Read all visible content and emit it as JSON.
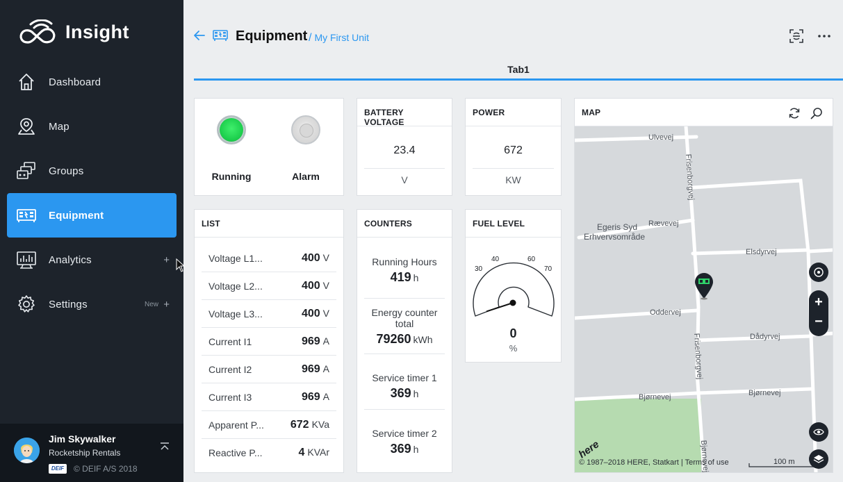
{
  "app": {
    "name": "Insight"
  },
  "sidebar": {
    "items": [
      {
        "label": "Dashboard",
        "icon": "home-icon"
      },
      {
        "label": "Map",
        "icon": "map-pin-icon"
      },
      {
        "label": "Groups",
        "icon": "groups-icon"
      },
      {
        "label": "Equipment",
        "icon": "equipment-icon",
        "active": true
      },
      {
        "label": "Analytics",
        "icon": "analytics-icon",
        "plus": "+"
      },
      {
        "label": "Settings",
        "icon": "gear-icon",
        "badge": "New",
        "plus": "+"
      }
    ]
  },
  "user": {
    "name": "Jim Skywalker",
    "org": "Rocketship Rentals",
    "brand": "DEIF",
    "copyright": "© DEIF A/S 2018"
  },
  "header": {
    "title": "Equipment",
    "crumb_sep": "/",
    "crumb": "My First Unit",
    "tab": "Tab1"
  },
  "status": {
    "running_label": "Running",
    "alarm_label": "Alarm"
  },
  "battery": {
    "title": "BATTERY VOLTAGE",
    "value": "23.4",
    "unit": "V"
  },
  "power": {
    "title": "POWER",
    "value": "672",
    "unit": "KW"
  },
  "list": {
    "title": "LIST",
    "rows": [
      {
        "key": "Voltage L1...",
        "value": "400",
        "unit": "V"
      },
      {
        "key": "Voltage L2...",
        "value": "400",
        "unit": "V"
      },
      {
        "key": "Voltage L3...",
        "value": "400",
        "unit": "V"
      },
      {
        "key": "Current I1",
        "value": "969",
        "unit": "A"
      },
      {
        "key": "Current I2",
        "value": "969",
        "unit": "A"
      },
      {
        "key": "Current I3",
        "value": "969",
        "unit": "A"
      },
      {
        "key": "Apparent P...",
        "value": "672",
        "unit": "KVa"
      },
      {
        "key": "Reactive P...",
        "value": "4",
        "unit": "KVAr"
      }
    ]
  },
  "counters": {
    "title": "COUNTERS",
    "items": [
      {
        "label": "Running Hours",
        "value": "419",
        "unit": "h"
      },
      {
        "label": "Energy counter total",
        "value": "79260",
        "unit": "kWh"
      },
      {
        "label": "Service timer 1",
        "value": "369",
        "unit": "h"
      },
      {
        "label": "Service timer 2",
        "value": "369",
        "unit": "h"
      }
    ]
  },
  "fuel": {
    "title": "FUEL LEVEL",
    "value": "0",
    "unit": "%",
    "ticks": [
      "30",
      "40",
      "60",
      "70"
    ],
    "level": 0
  },
  "map": {
    "title": "MAP",
    "streets": [
      "Ulvevej",
      "Frisenborgvej",
      "Rævevej",
      "Egeris Syd",
      "Erhvervsområde",
      "Elsdyrvej",
      "Oddervej",
      "Dådyrvej",
      "Frisenborgvej",
      "Bjørnevej",
      "Bjørnevej",
      "Bjørnevej"
    ],
    "logo": "here",
    "copyright": "© 1987–2018 HERE, Statkart | Terms of use",
    "scale": "100 m",
    "zoom_in": "+",
    "zoom_out": "−"
  }
}
